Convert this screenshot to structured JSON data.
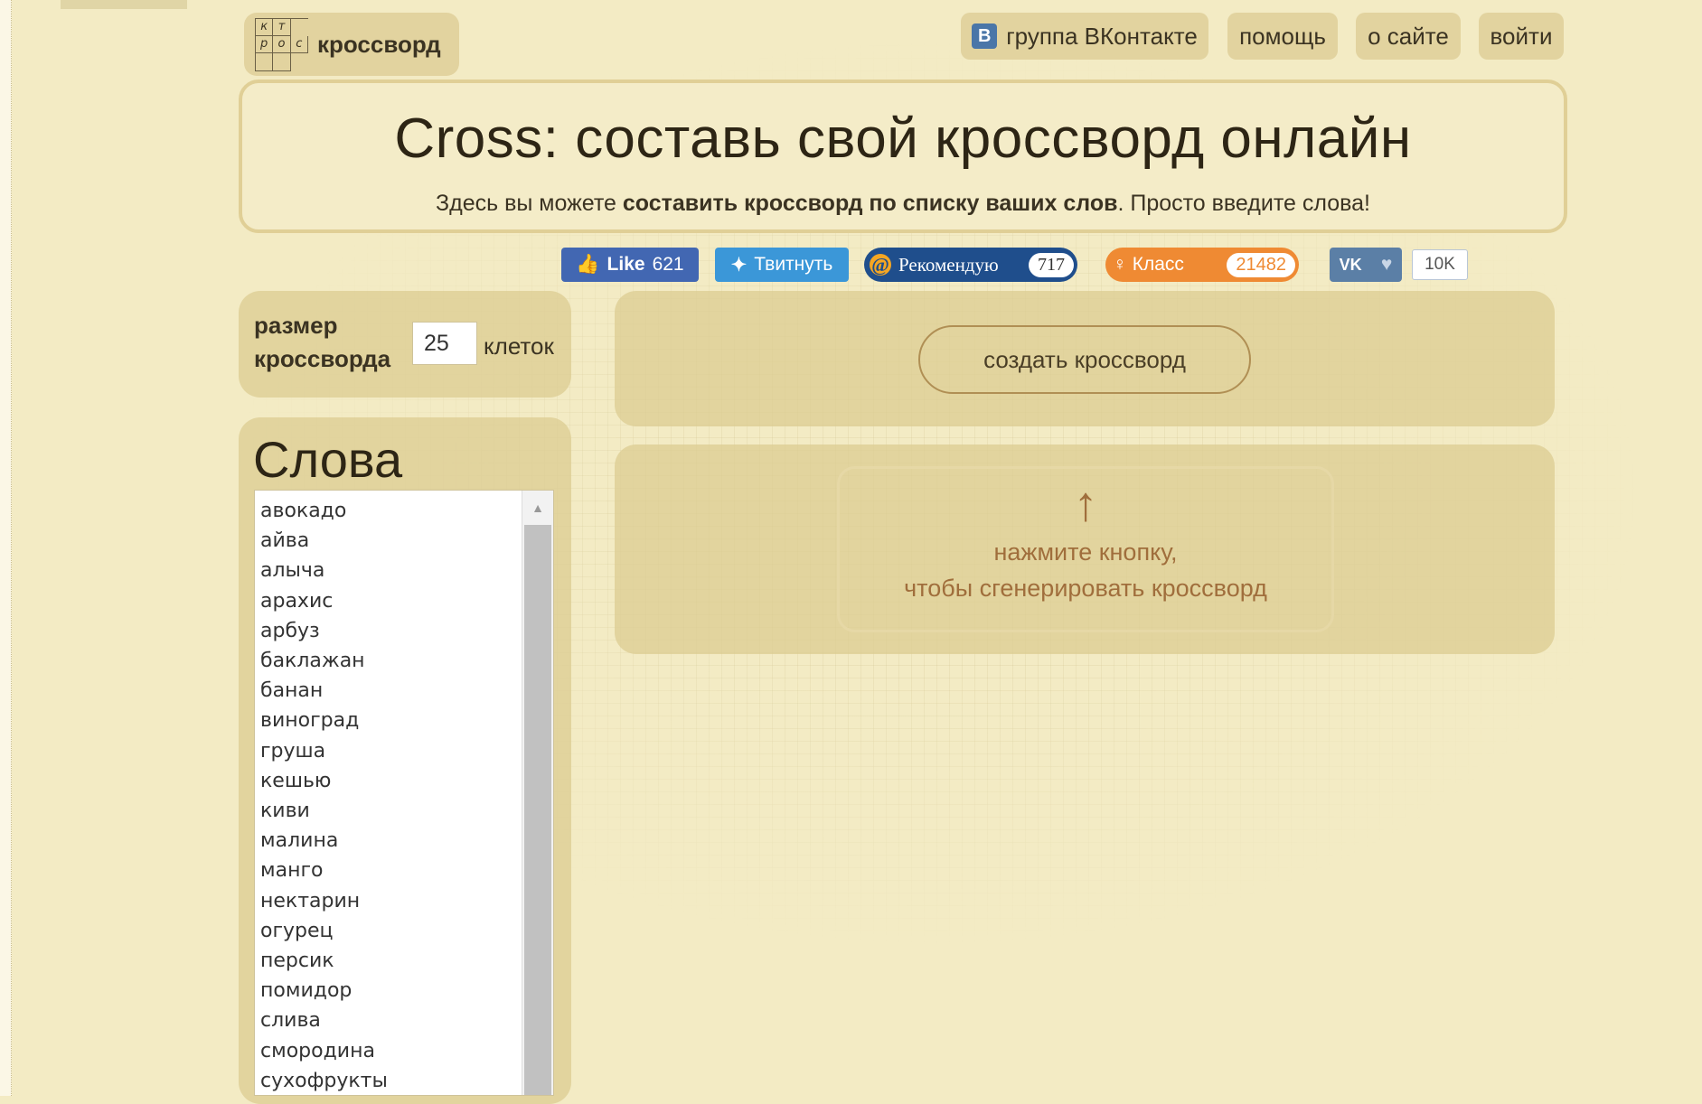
{
  "logo": {
    "text": "кроссворд",
    "grid_letters": [
      "к",
      "т",
      "",
      "р",
      "о",
      "с",
      "",
      "",
      ""
    ]
  },
  "nav": {
    "vk_group": "группа ВКонтакте",
    "vk_icon": "B",
    "help": "помощь",
    "about": "о сайте",
    "login": "войти"
  },
  "header": {
    "title": "Cross: составь свой кроссворд онлайн",
    "sub_prefix": "Здесь вы можете ",
    "sub_bold": "составить кроссворд по списку ваших слов",
    "sub_suffix": ". Просто введите слова!"
  },
  "social": {
    "fb_label": "Like",
    "fb_count": "621",
    "tw_label": "Твитнуть",
    "mr_label": "Рекомендую",
    "mr_count": "717",
    "ok_label": "Класс",
    "ok_count": "21482",
    "vk_label": "VK",
    "vk_count": "10K"
  },
  "size": {
    "label_line1": "размер",
    "label_line2": "кроссворда",
    "value": "25",
    "unit": "клеток"
  },
  "create": {
    "label": "создать кроссворд"
  },
  "hint": {
    "arrow": "↑",
    "line1": "нажмите кнопку,",
    "line2": "чтобы сгенерировать кроссворд"
  },
  "words": {
    "title": "Слова",
    "items": [
      "авокадо",
      "айва",
      "алыча",
      "арахис",
      "арбуз",
      "баклажан",
      "банан",
      "виноград",
      "груша",
      "кешью",
      "киви",
      "малина",
      "манго",
      "нектарин",
      "огурец",
      "персик",
      "помидор",
      "слива",
      "смородина",
      "сухофрукты"
    ]
  }
}
